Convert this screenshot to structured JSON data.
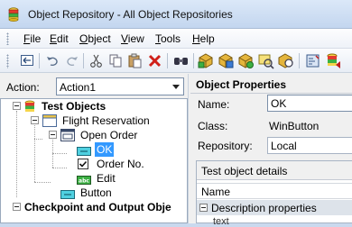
{
  "window": {
    "title": "Object Repository - All Object Repositories"
  },
  "menu": {
    "items": [
      {
        "pre": "",
        "acc": "F",
        "post": "ile"
      },
      {
        "pre": "",
        "acc": "E",
        "post": "dit"
      },
      {
        "pre": "",
        "acc": "O",
        "post": "bject"
      },
      {
        "pre": "",
        "acc": "V",
        "post": "iew"
      },
      {
        "pre": "",
        "acc": "T",
        "post": "ools"
      },
      {
        "pre": "",
        "acc": "H",
        "post": "elp"
      }
    ]
  },
  "toolbar": {
    "icons": [
      "navigate-back-icon",
      "undo-icon",
      "redo-icon",
      "cut-icon",
      "copy-icon",
      "paste-icon",
      "delete-icon",
      "find-icon",
      "add-objects-icon",
      "update-from-app-icon",
      "add-checkpoint-icon",
      "highlight-icon",
      "locate-icon",
      "object-spy-icon",
      "export-icon"
    ]
  },
  "action": {
    "label": "Action:",
    "selected": "Action1"
  },
  "tree": {
    "root_test_objects": "Test Objects",
    "flight_reservation": "Flight Reservation",
    "open_order": "Open Order",
    "ok": "OK",
    "order_no": "Order No.",
    "edit": "Edit",
    "button": "Button",
    "checkpoint_root": "Checkpoint and Output Obje"
  },
  "properties": {
    "header": "Object Properties",
    "name_label": "Name:",
    "name_value": "OK",
    "class_label": "Class:",
    "class_value": "WinButton",
    "repository_label": "Repository:",
    "repository_value": "Local",
    "details_header": "Test object details",
    "column_name": "Name",
    "group_description": "Description properties",
    "cut_row": "text"
  },
  "colors": {
    "selection": "#3399ff",
    "title_gradient_top": "#dbe8f8",
    "title_gradient_bottom": "#c3d6ef"
  }
}
